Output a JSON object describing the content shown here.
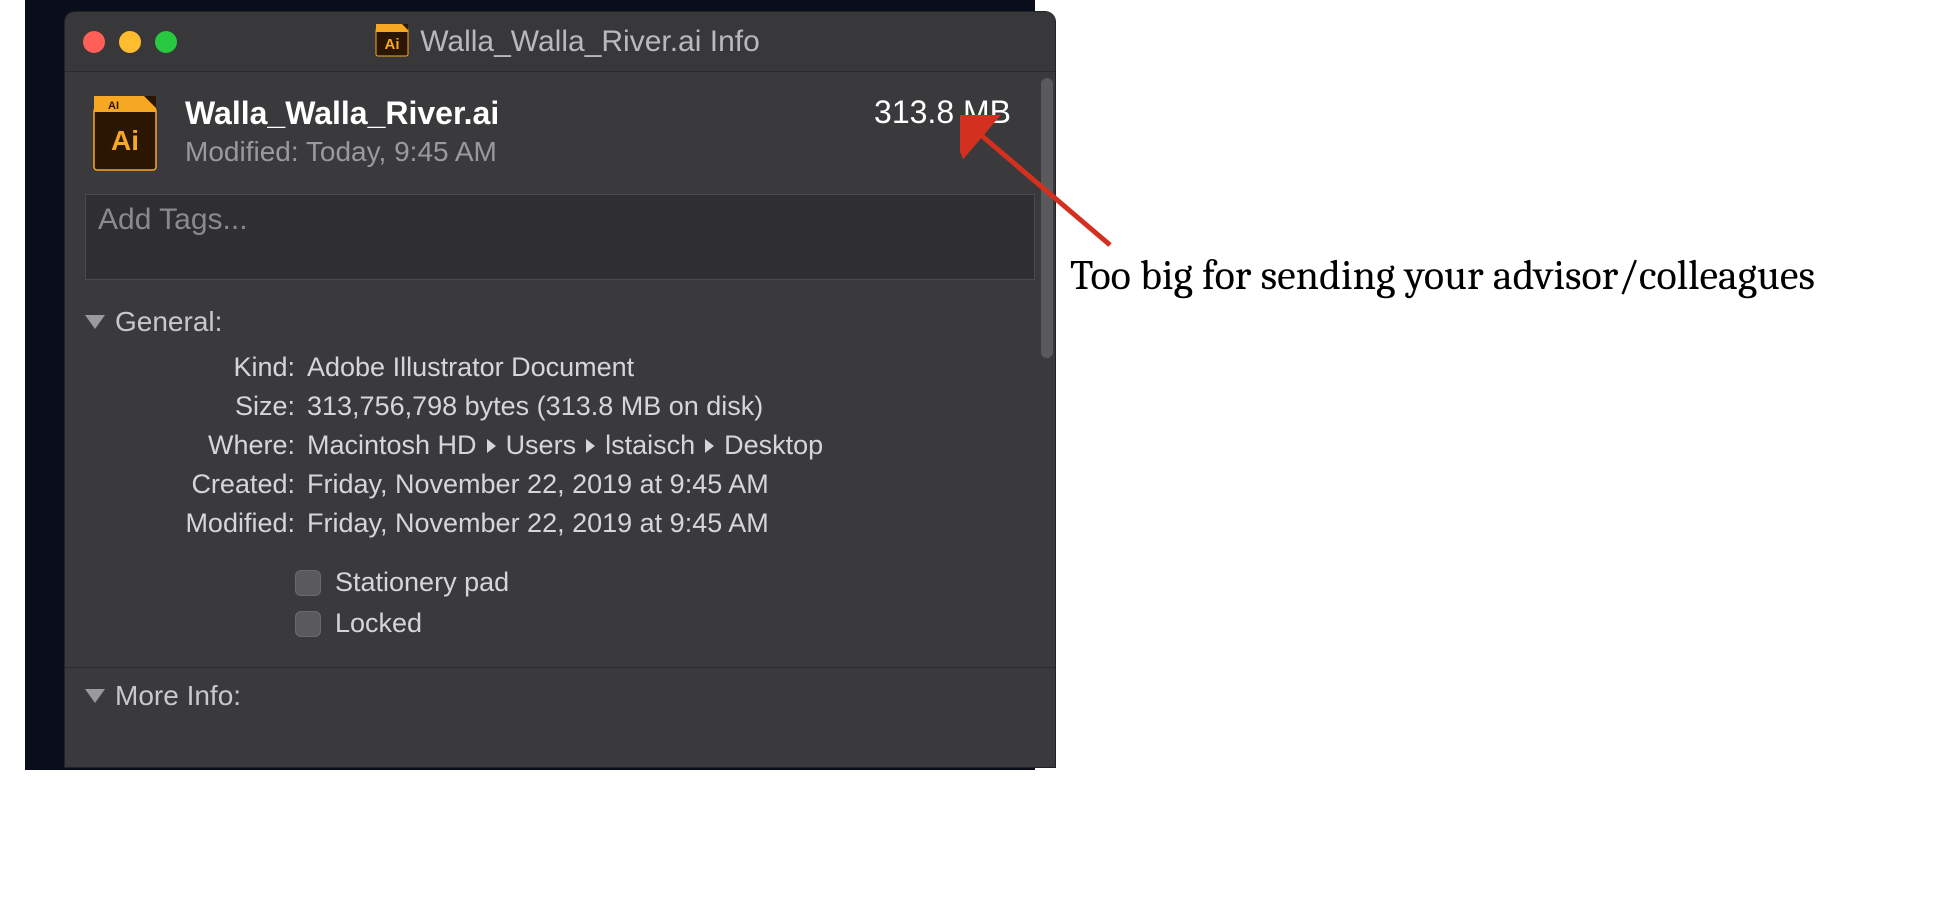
{
  "window": {
    "title": "Walla_Walla_River.ai Info"
  },
  "header": {
    "filename": "Walla_Walla_River.ai",
    "modified_label": "Modified:",
    "modified_value": "Today, 9:45 AM",
    "filesize": "313.8 MB"
  },
  "tags": {
    "placeholder": "Add Tags..."
  },
  "sections": {
    "general": {
      "title": "General:",
      "labels": {
        "kind": "Kind:",
        "size": "Size:",
        "where": "Where:",
        "created": "Created:",
        "modified": "Modified:"
      },
      "values": {
        "kind": "Adobe Illustrator Document",
        "size": "313,756,798 bytes (313.8 MB on disk)",
        "where": [
          "Macintosh HD",
          "Users",
          "lstaisch",
          "Desktop"
        ],
        "created": "Friday, November 22, 2019 at 9:45 AM",
        "modified": "Friday, November 22, 2019 at 9:45 AM"
      },
      "checkbox_labels": {
        "stationery": "Stationery pad",
        "locked": "Locked"
      }
    },
    "more_info": {
      "title": "More Info:"
    }
  },
  "annotation": {
    "text": "Too big for sending your advisor/colleagues"
  },
  "colors": {
    "arrow": "#d3301f"
  }
}
